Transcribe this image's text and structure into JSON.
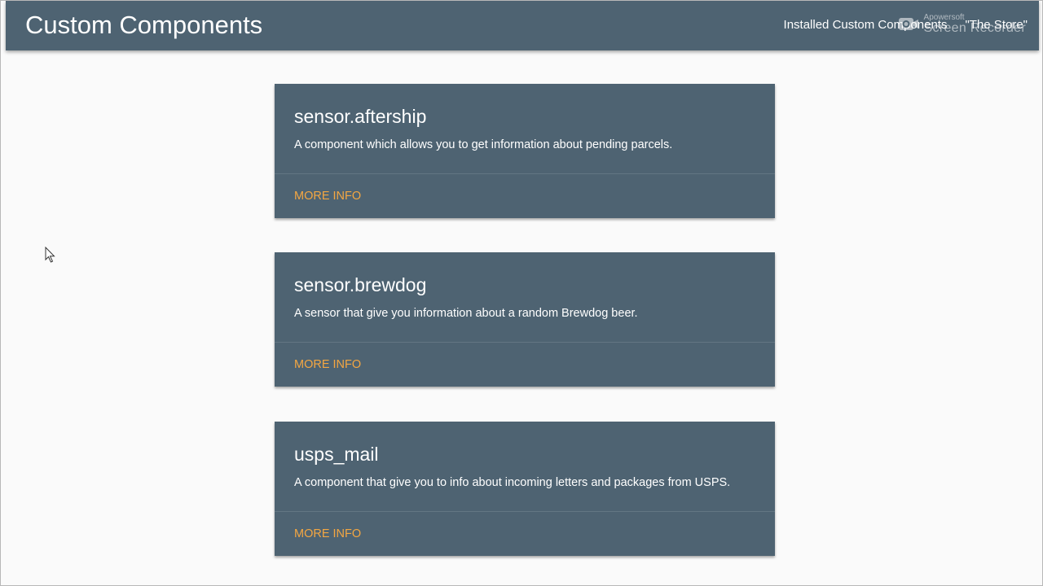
{
  "header": {
    "title": "Custom Components",
    "nav": [
      {
        "label": "Installed Custom Components"
      },
      {
        "label": "\"The Store\""
      }
    ],
    "watermark": {
      "brand": "Apowersoft",
      "product": "Screen Recorder"
    }
  },
  "cards": [
    {
      "title": "sensor.aftership",
      "description": "A component which allows you to get information about pending parcels.",
      "action": "MORE INFO"
    },
    {
      "title": "sensor.brewdog",
      "description": "A sensor that give you information about a random Brewdog beer.",
      "action": "MORE INFO"
    },
    {
      "title": "usps_mail",
      "description": "A component that give you to info about incoming letters and packages from USPS.",
      "action": "MORE INFO"
    }
  ],
  "colors": {
    "header_bg": "#4e6372",
    "card_bg": "#4e6372",
    "accent": "#f4a742",
    "page_bg": "#fafafa"
  },
  "icons": [
    "camera-icon",
    "mouse-pointer-icon"
  ]
}
